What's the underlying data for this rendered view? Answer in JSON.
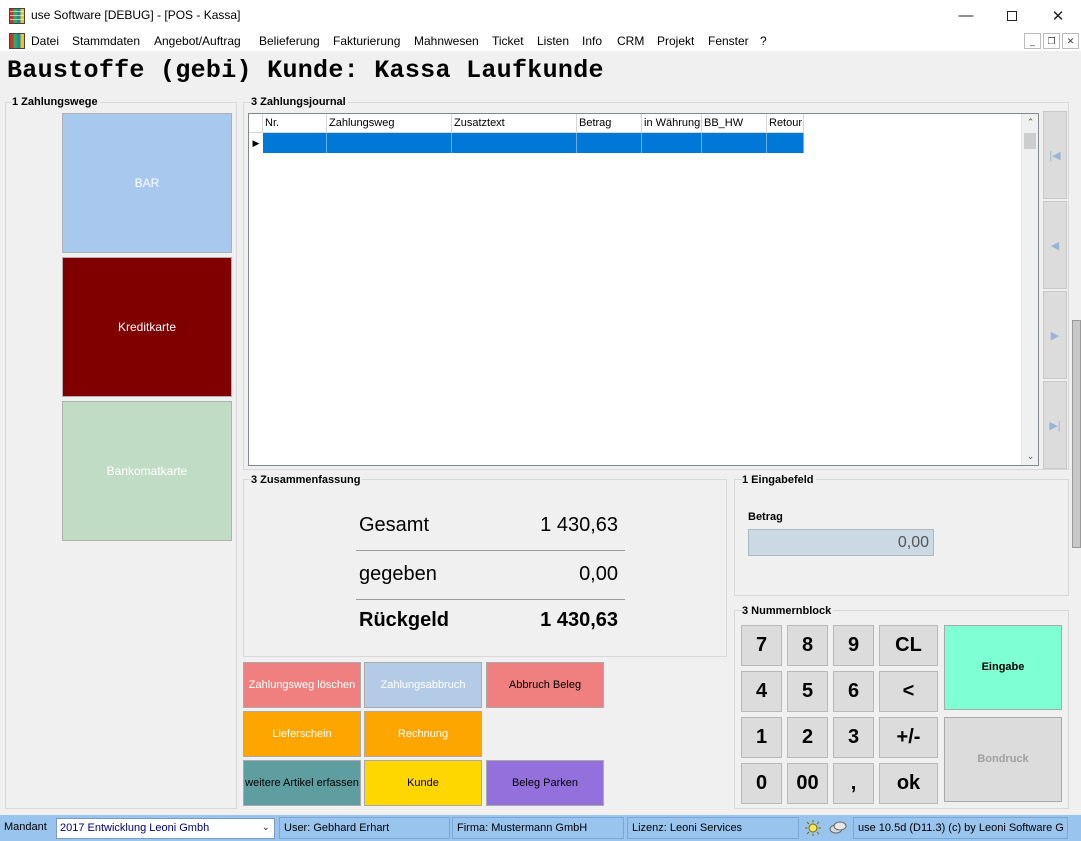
{
  "window": {
    "title": "use Software [DEBUG] - [POS - Kassa]",
    "min_glyph": "—",
    "close_glyph": "✕"
  },
  "menu": {
    "items": [
      "Datei",
      "Stammdaten",
      "Angebot/Auftrag",
      "Belieferung",
      "Fakturierung",
      "Mahnwesen",
      "Ticket",
      "Listen",
      "Info",
      "CRM",
      "Projekt",
      "Fenster",
      "?"
    ],
    "mdi_min": "_",
    "mdi_restore": "❐",
    "mdi_close": "✕"
  },
  "header": {
    "title": "Baustoffe (gebi) Kunde: Kassa Laufkunde"
  },
  "payment_methods": {
    "group_title": "1 Zahlungswege",
    "items": [
      {
        "label": "BAR",
        "color": "#a9c8ee"
      },
      {
        "label": "Kreditkarte",
        "color": "#800000"
      },
      {
        "label": "Bankomatkarte",
        "color": "#c1dcc4"
      }
    ]
  },
  "journal": {
    "group_title": "3 Zahlungsjournal",
    "columns": [
      "Nr.",
      "Zahlungsweg",
      "Zusatztext",
      "Betrag",
      "in Währung",
      "BB_HW",
      "Retour"
    ],
    "row_indicator": "▶",
    "selection_color": "#0078d7",
    "scroll_up": "⌃",
    "scroll_down": "⌄"
  },
  "navigation": {
    "first": "|◀",
    "prev": "◀",
    "next": "▶",
    "last": "▶|"
  },
  "summary": {
    "group_title": "3 Zusammenfassung",
    "gesamt_label": "Gesamt",
    "gesamt_value": "1 430,63",
    "gegeben_label": "gegeben",
    "gegeben_value": "0,00",
    "rueckgeld_label": "Rückgeld",
    "rueckgeld_value": "1 430,63"
  },
  "input_field": {
    "group_title": "1 Eingabefeld",
    "label": "Betrag",
    "value": "0,00"
  },
  "actions": {
    "zahlungsweg_loeschen": "Zahlungsweg löschen",
    "zahlungsabbruch": "Zahlungsabbruch",
    "abbruch_beleg": "Abbruch Beleg",
    "lieferschein": "Lieferschein",
    "rechnung": "Rechnung",
    "weitere_artikel": "weitere Artikel erfassen",
    "kunde": "Kunde",
    "beleg_parken": "Beleg Parken"
  },
  "keypad": {
    "group_title": "3 Nummernblock",
    "keys": [
      "7",
      "8",
      "9",
      "CL",
      "4",
      "5",
      "6",
      "<",
      "1",
      "2",
      "3",
      "+/-",
      "0",
      "00",
      ",",
      "ok"
    ],
    "eingabe": "Eingabe",
    "bondruck": "Bondruck"
  },
  "statusbar": {
    "mandant_label": "Mandant",
    "mandant_value": "2017  Entwicklung Leoni Gmbh",
    "user": "User: Gebhard Erhart",
    "firma": "Firma: Mustermann GmbH",
    "lizenz": "Lizenz: Leoni Services",
    "version": "use 10.5d (D11.3) (c) by Leoni Software G",
    "chevron": "⌄"
  }
}
